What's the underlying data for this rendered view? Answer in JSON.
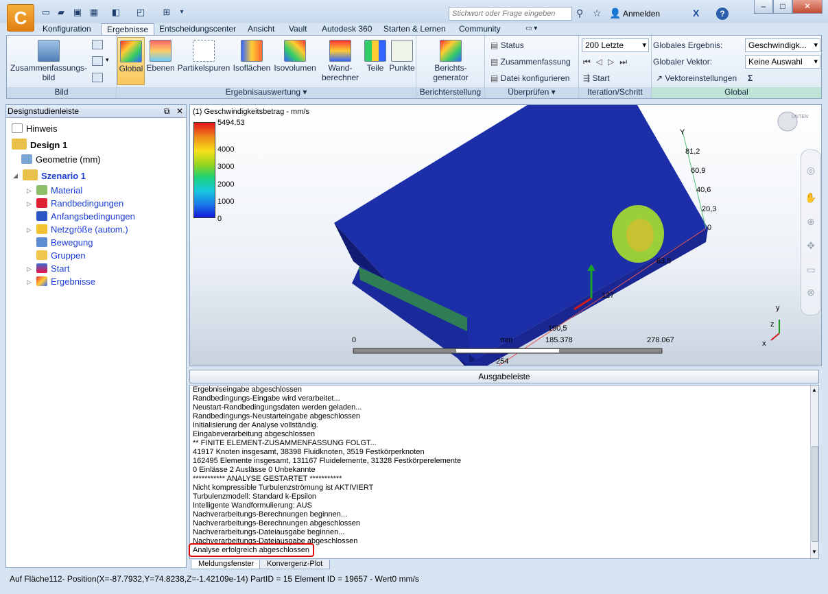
{
  "app": {
    "logo_letter": "C"
  },
  "titlebar": {
    "search_placeholder": "Stichwort oder Frage eingeben",
    "login_label": "Anmelden",
    "help_label": "?",
    "minimize": "–",
    "maximize": "□",
    "close": "✕"
  },
  "tabs": [
    "Konfiguration",
    "Ergebnisse",
    "Entscheidungscenter",
    "Ansicht",
    "Vault",
    "Autodesk 360",
    "Starten & Lernen",
    "Community"
  ],
  "ribbon": {
    "bild": {
      "summary_label": "Zusammenfassungs-bild",
      "group_label": "Bild"
    },
    "auswertung": {
      "buttons": [
        "Global",
        "Ebenen",
        "Partikelspuren",
        "Isoflächen",
        "Isovolumen",
        "Wand-berechner",
        "Teile",
        "Punkte"
      ],
      "group_label": "Ergebnisauswertung ▾"
    },
    "bericht": {
      "button_label": "Berichts-generator",
      "group_label": "Berichterstellung"
    },
    "ueberpruefen": {
      "status": "Status",
      "zusammenfassung": "Zusammenfassung",
      "datei": "Datei konfigurieren",
      "group_label": "Überprüfen ▾"
    },
    "iteration": {
      "combo_value": "200 Letzte",
      "start": "Start",
      "group_label": "Iteration/Schritt"
    },
    "global": {
      "ergebnis_label": "Globales Ergebnis:",
      "ergebnis_value": "Geschwindigk...",
      "vektor_label": "Globaler Vektor:",
      "vektor_value": "Keine Auswahl",
      "vektoreinstellungen": "Vektoreinstellungen",
      "group_label": "Global"
    }
  },
  "leftpanel": {
    "title": "Designstudienleiste",
    "tree": [
      "Hinweis",
      "Design 1",
      "Geometrie (mm)",
      "Szenario 1",
      "Material",
      "Randbedingungen",
      "Anfangsbedingungen",
      "Netzgröße (autom.)",
      "Bewegung",
      "Gruppen",
      "Start",
      "Ergebnisse"
    ]
  },
  "viewport": {
    "legend_title": "(1) Geschwindigkeitsbetrag - mm/s",
    "legend_ticks": [
      "5494.53",
      "4000",
      "3000",
      "2000",
      "1000",
      "0"
    ],
    "axis_labels": [
      "Y",
      "81,2",
      "60,9",
      "40,6",
      "20,3",
      "0",
      "63,5",
      "127",
      "190,5",
      "254"
    ],
    "scale_labels": [
      "0",
      "mm",
      "185.378",
      "278.067"
    ],
    "triad": {
      "y": "y",
      "z": "z",
      "x": "x"
    },
    "cube_label": "UNTEN"
  },
  "output": {
    "header": "Ausgabeleiste",
    "lines": [
      "Ergebniseingabe abgeschlossen",
      "Randbedingungs-Eingabe wird verarbeitet...",
      "Neustart-Randbedingungsdaten werden geladen...",
      "Randbedingungs-Neustarteingabe abgeschlossen",
      "Initialisierung der Analyse vollständig.",
      "Eingabeverarbeitung abgeschlossen",
      "** FINITE ELEMENT-ZUSAMMENFASSUNG FOLGT...",
      "41917 Knoten insgesamt,   38398 Fluidknoten,   3519 Festkörperknoten",
      "162495 Elemente insgesamt,   131167 Fluidelemente,   31328 Festkörperelemente",
      "0 Einlässe   2 Auslässe   0 Unbekannte",
      "*********** ANALYSE GESTARTET ***********",
      "Nicht kompressible Turbulenzströmung ist AKTIVIERT",
      "Turbulenzmodell: Standard k-Epsilon",
      "Intelligente Wandformulierung: AUS",
      "Nachverarbeitungs-Berechnungen beginnen...",
      "Nachverarbeitungs-Berechnungen abgeschlossen",
      "Nachverarbeitungs-Dateiausgabe beginnen...",
      "Nachverarbeitungs-Dateiausgabe abgeschlossen",
      "Analyse erfolgreich abgeschlossen"
    ],
    "tabs": [
      "Meldungsfenster",
      "Konvergenz-Plot"
    ]
  },
  "status": "Auf Fläche112- Position(X=-87.7932,Y=74.8238,Z=-1.42109e-14) PartID = 15 Element ID = 19657 - Wert0  mm/s",
  "colors": {
    "accent": "#f29b26",
    "model_blue": "#1d2fa8",
    "highlight": "#e00000"
  }
}
